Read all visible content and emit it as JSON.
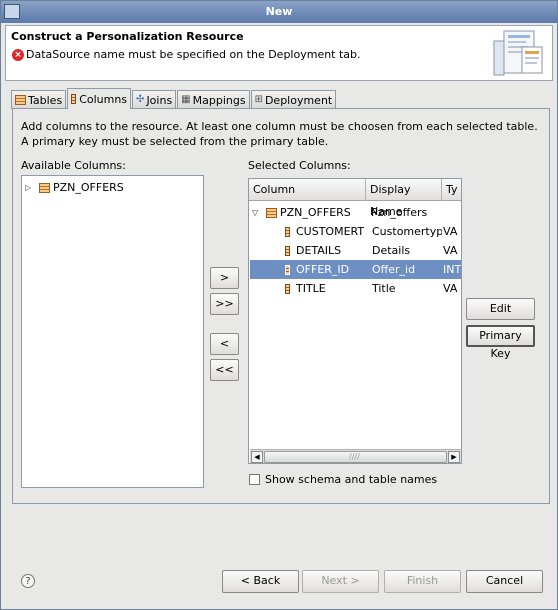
{
  "window": {
    "title": "New"
  },
  "header": {
    "title": "Construct a Personalization Resource",
    "error_icon": "error-icon",
    "error_message": "DataSource name must be specified on the Deployment tab."
  },
  "tabs": [
    {
      "label": "Tables",
      "icon": "table-icon"
    },
    {
      "label": "Columns",
      "icon": "column-icon",
      "active": true
    },
    {
      "label": "Joins",
      "icon": "joins-icon"
    },
    {
      "label": "Mappings",
      "icon": "mappings-icon"
    },
    {
      "label": "Deployment",
      "icon": "deployment-icon"
    }
  ],
  "instructions": "Add columns to the resource.  At least one column must be choosen from each selected table.  A primary key must be selected from the primary table.",
  "available": {
    "label": "Available Columns:",
    "items": [
      {
        "name": "PZN_OFFERS",
        "expanded": false
      }
    ]
  },
  "transfer_buttons": {
    "add": ">",
    "add_all": ">>",
    "remove": "<",
    "remove_all": "<<"
  },
  "selected": {
    "label": "Selected Columns:",
    "columns": [
      "Column",
      "Display Name",
      "Ty"
    ],
    "rows": [
      {
        "column": "PZN_OFFERS",
        "display": "Pzn_offers",
        "type": "",
        "level": 0
      },
      {
        "column": "CUSTOMERT",
        "display": "Customertype",
        "type": "VA",
        "level": 1
      },
      {
        "column": "DETAILS",
        "display": "Details",
        "type": "VA",
        "level": 1
      },
      {
        "column": "OFFER_ID",
        "display": "Offer_id",
        "type": "INT",
        "level": 1,
        "selected": true,
        "primary_key": true
      },
      {
        "column": "TITLE",
        "display": "Title",
        "type": "VA",
        "level": 1
      }
    ]
  },
  "side_buttons": {
    "edit": "Edit",
    "primary_key": "Primary Key"
  },
  "checkbox": {
    "label": "Show schema and table names",
    "checked": false
  },
  "footer": {
    "back": "< Back",
    "next": "Next >",
    "finish": "Finish",
    "cancel": "Cancel"
  },
  "colors": {
    "title_bar": "#6c88b5",
    "selection": "#6d8fc4",
    "error": "#d72b2b"
  }
}
